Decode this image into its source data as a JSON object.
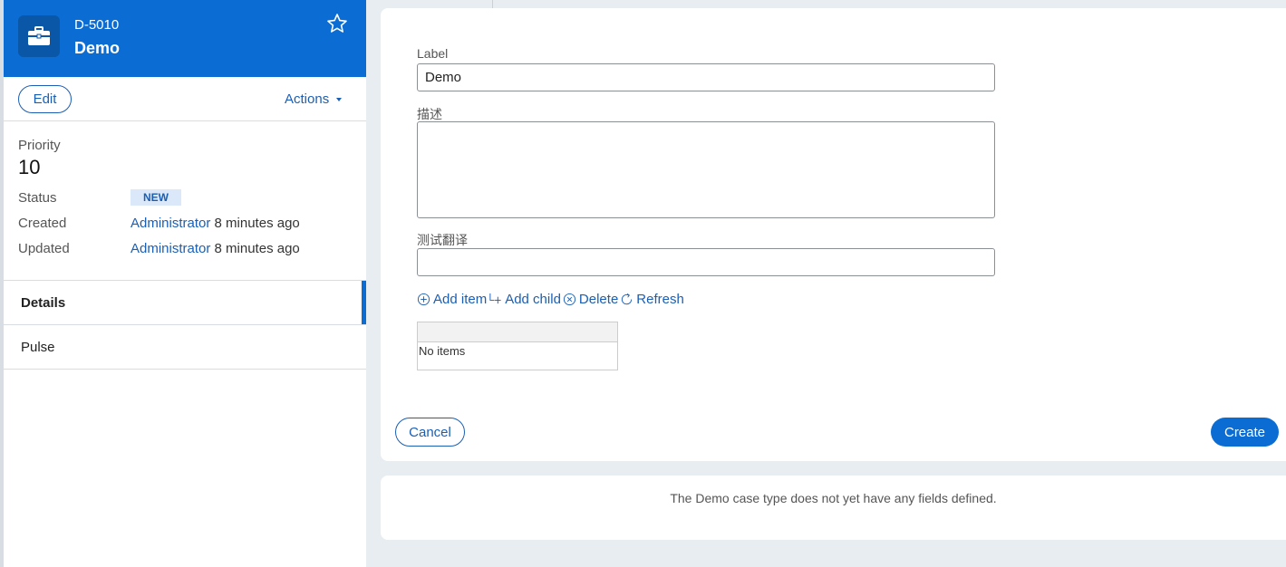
{
  "header": {
    "case_id": "D-5010",
    "case_title": "Demo",
    "icon": "briefcase-icon",
    "favorite_icon": "star-icon",
    "bg_color": "#0b6dd3"
  },
  "actions_bar": {
    "edit_label": "Edit",
    "actions_label": "Actions"
  },
  "summary": {
    "priority_label": "Priority",
    "priority_value": "10",
    "status_label": "Status",
    "status_value": "NEW",
    "created_label": "Created",
    "created_by": "Administrator",
    "created_time": "8 minutes ago",
    "updated_label": "Updated",
    "updated_by": "Administrator",
    "updated_time": "8 minutes ago"
  },
  "nav": {
    "items": [
      {
        "label": "Details",
        "active": true
      },
      {
        "label": "Pulse",
        "active": false
      }
    ]
  },
  "form": {
    "label_field": {
      "label": "Label",
      "value": "Demo"
    },
    "description_field": {
      "label": "描述",
      "value": ""
    },
    "translation_field": {
      "label": "测试翻译",
      "value": ""
    },
    "toolbar": {
      "add_item": "Add item",
      "add_child": "Add child",
      "delete": "Delete",
      "refresh": "Refresh"
    },
    "grid": {
      "empty_text": "No items"
    },
    "cancel_label": "Cancel",
    "create_label": "Create"
  },
  "info_card": {
    "message": "The Demo case type does not yet have any fields defined."
  },
  "colors": {
    "accent": "#0b6dd3",
    "link": "#1a5fb4",
    "background": "#e8edf2"
  }
}
